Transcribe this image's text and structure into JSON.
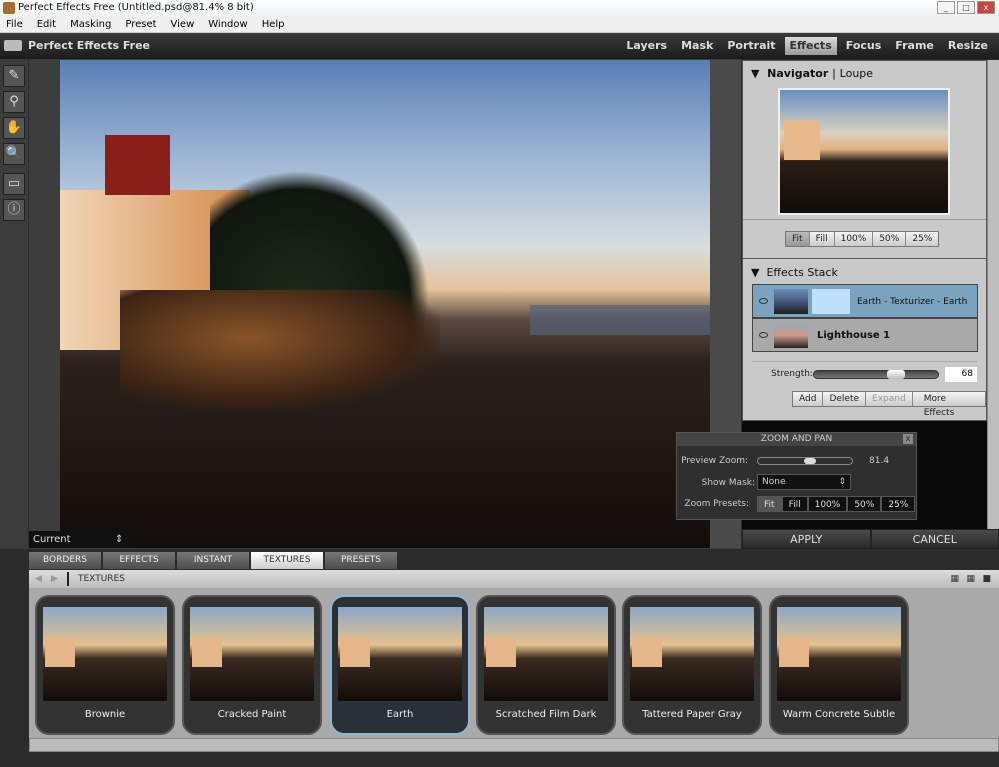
{
  "window": {
    "title": "Perfect Effects Free (Untitled.psd@81.4% 8 bit)"
  },
  "menu": [
    "File",
    "Edit",
    "Masking",
    "Preset",
    "View",
    "Window",
    "Help"
  ],
  "app": {
    "name": "Perfect Effects Free",
    "modules": [
      "Layers",
      "Mask",
      "Portrait",
      "Effects",
      "Focus",
      "Frame",
      "Resize"
    ],
    "active_module": "Effects"
  },
  "canvas": {
    "view_select": "Current"
  },
  "navigator": {
    "title": "Navigator",
    "alt_tab": "Loupe",
    "zoom_buttons": [
      "Fit",
      "Fill",
      "100%",
      "50%",
      "25%"
    ],
    "active": "Fit"
  },
  "effects_stack": {
    "title": "Effects Stack",
    "layers": [
      {
        "name": "Earth - Texturizer - Earth",
        "selected": true
      },
      {
        "name": "Lighthouse 1",
        "selected": false
      }
    ],
    "strength_label": "Strength:",
    "strength": 68,
    "buttons": [
      "Add",
      "Delete",
      "Expand",
      "More Effects"
    ],
    "disabled": "Expand"
  },
  "zoom_pan": {
    "title": "ZOOM AND PAN",
    "close": "x",
    "preview_zoom_label": "Preview Zoom:",
    "preview_zoom": "81.4",
    "show_mask_label": "Show Mask:",
    "show_mask": "None",
    "presets_label": "Zoom Presets:",
    "presets": [
      "Fit",
      "Fill",
      "100%",
      "50%",
      "25%"
    ],
    "active": "Fit"
  },
  "actions": {
    "apply": "APPLY",
    "cancel": "CANCEL"
  },
  "browser": {
    "tabs": [
      "BORDERS",
      "EFFECTS",
      "INSTANT",
      "TEXTURES",
      "PRESETS"
    ],
    "active_tab": "TEXTURES",
    "path": "TEXTURES",
    "thumbnails": [
      "Brownie",
      "Cracked Paint",
      "Earth",
      "Scratched Film Dark",
      "Tattered Paper Gray",
      "Warm Concrete Subtle"
    ],
    "selected": "Earth"
  }
}
